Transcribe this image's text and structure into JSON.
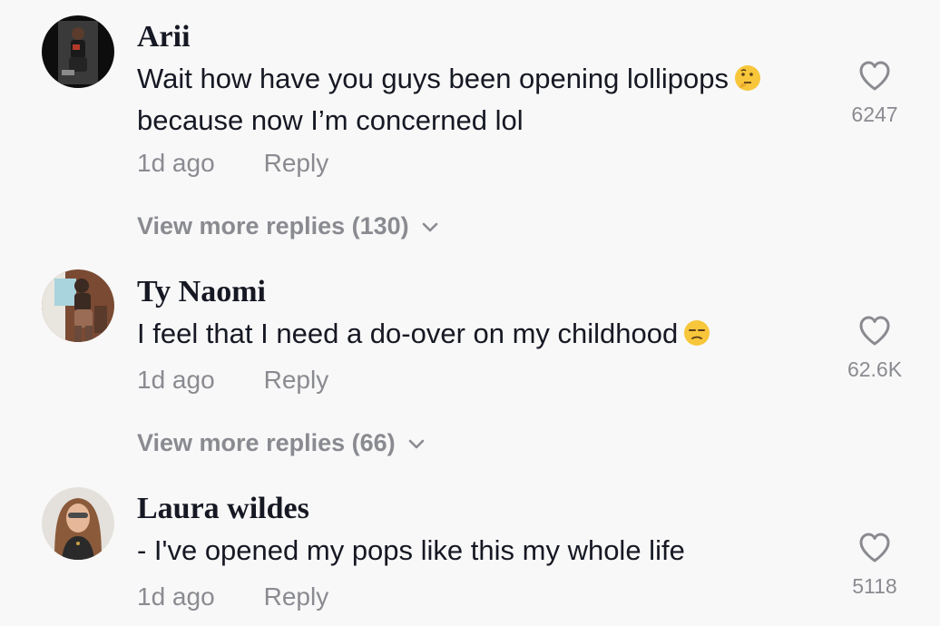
{
  "comments": [
    {
      "username": "Arii",
      "text_line1": "Wait how have you guys been opening lollipops",
      "text_line2": "because now I’m concerned lol",
      "emoji": "thinking-face",
      "time": "1d ago",
      "reply_label": "Reply",
      "likes": "6247",
      "view_more": "View more replies (130)"
    },
    {
      "username": "Ty Naomi",
      "text_line1": "I feel that I need a do-over on my childhood",
      "emoji": "unamused-face",
      "time": "1d ago",
      "reply_label": "Reply",
      "likes": "62.6K",
      "view_more": "View more replies (66)"
    },
    {
      "username": "Laura wildes",
      "text_line1": "- I've opened my pops like this my whole life",
      "time": "1d ago",
      "reply_label": "Reply",
      "likes": "5118"
    }
  ],
  "colors": {
    "background": "#f8f8f8",
    "text": "#161823",
    "secondary": "#8a8b91",
    "emoji": "#f7c63a"
  },
  "icons": [
    "heart-outline-icon",
    "chevron-down-icon",
    "thinking-face-emoji",
    "unamused-face-emoji"
  ]
}
